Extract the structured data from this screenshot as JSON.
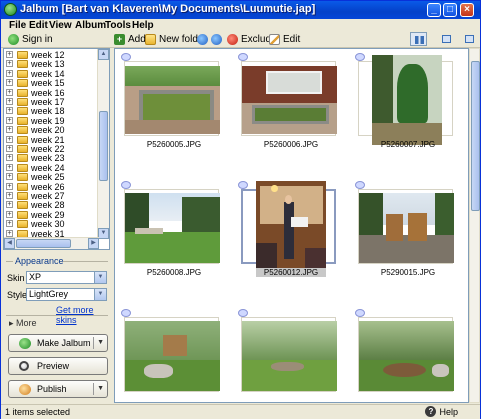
{
  "window": {
    "title": "Jalbum [Bart van Klaveren\\My Documents\\Luumutie.jap]"
  },
  "menu": [
    "File",
    "Edit",
    "View",
    "Album",
    "Tools",
    "Help"
  ],
  "toolbar": {
    "sign_in": "Sign in",
    "add": "Add",
    "new_folder": "New folder",
    "exclude": "Exclude",
    "edit": "Edit"
  },
  "tree": {
    "items": [
      "week 12",
      "week 13",
      "week 14",
      "week 15",
      "week 16",
      "week 17",
      "week 18",
      "week 19",
      "week 20",
      "week 21",
      "week 22",
      "week 23",
      "week 24",
      "week 25",
      "week 26",
      "week 27",
      "week 28",
      "week 29",
      "week 30",
      "week 31"
    ]
  },
  "appearance": {
    "title": "Appearance",
    "skin_label": "Skin",
    "skin_value": "XP",
    "style_label": "Style",
    "style_value": "LightGrey",
    "more_skins": "Get more skins",
    "more": "More"
  },
  "actions": {
    "make": "Make Jalbum",
    "preview": "Preview",
    "publish": "Publish"
  },
  "thumbnails": [
    {
      "filename": "P5260005.JPG",
      "scene": "garden-bed",
      "selected": false
    },
    {
      "filename": "P5260006.JPG",
      "scene": "house-garden",
      "selected": false
    },
    {
      "filename": "P5260007.JPG",
      "scene": "forest-tree",
      "selected": false
    },
    {
      "filename": "P5260008.JPG",
      "scene": "lawn-trees",
      "selected": false
    },
    {
      "filename": "P5260012.JPG",
      "scene": "indoor-people",
      "selected": true
    },
    {
      "filename": "P5290015.JPG",
      "scene": "sheds",
      "selected": false
    },
    {
      "filename": "",
      "scene": "forest-shed",
      "selected": false
    },
    {
      "filename": "",
      "scene": "forest-rock",
      "selected": false
    },
    {
      "filename": "",
      "scene": "forest-clearing",
      "selected": false
    }
  ],
  "status": {
    "text": "1 items selected",
    "help": "Help"
  }
}
